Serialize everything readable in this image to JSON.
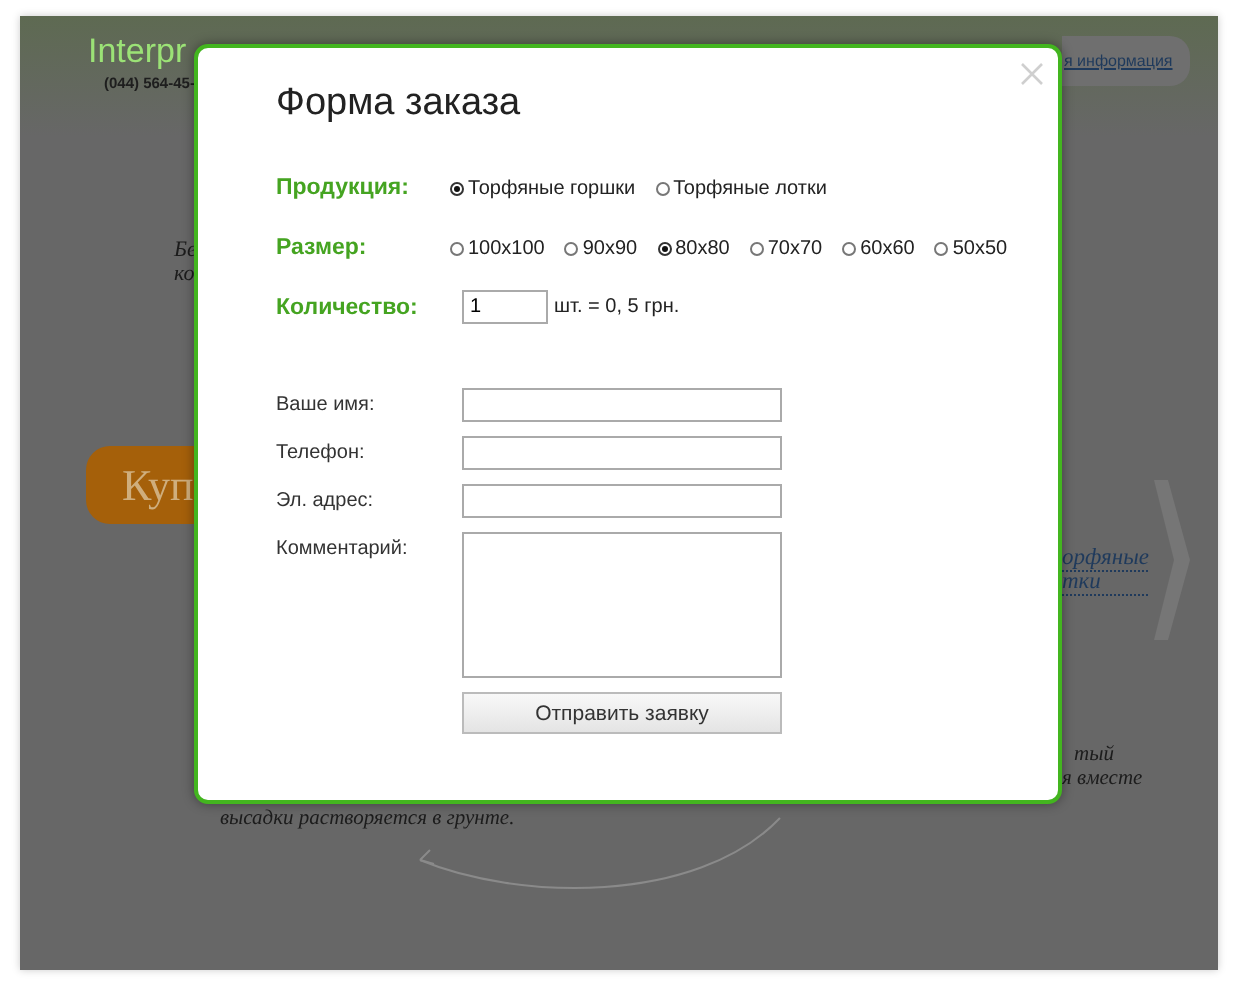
{
  "background_page": {
    "logo": "Interpr",
    "phone": "(044) 564-45-",
    "info_link": "я информация",
    "left_text": [
      "Бе",
      "ко"
    ],
    "buy_button": "Куп",
    "right_link": [
      "орфяные",
      "тки"
    ],
    "right_text": [
      "тый",
      "я вместе"
    ],
    "caption": "высадки растворяется в грунте."
  },
  "modal": {
    "title": "Форма заказа",
    "product": {
      "label": "Продукция:",
      "options": [
        {
          "label": "Торфяные горшки",
          "selected": true
        },
        {
          "label": "Торфяные лотки",
          "selected": false
        }
      ]
    },
    "size": {
      "label": "Размер:",
      "options": [
        {
          "label": "100x100",
          "selected": false
        },
        {
          "label": "90x90",
          "selected": false
        },
        {
          "label": "80x80",
          "selected": true
        },
        {
          "label": "70x70",
          "selected": false
        },
        {
          "label": "60x60",
          "selected": false
        },
        {
          "label": "50x50",
          "selected": false
        }
      ]
    },
    "quantity": {
      "label": "Количество:",
      "value": "1",
      "note": "шт. = 0, 5 грн."
    },
    "fields": [
      {
        "label": "Ваше имя:",
        "kind": "input"
      },
      {
        "label": "Телефон:",
        "kind": "input"
      },
      {
        "label": "Эл. адрес:",
        "kind": "input"
      },
      {
        "label": "Комментарий:",
        "kind": "textarea"
      }
    ],
    "submit": "Отправить заявку"
  }
}
